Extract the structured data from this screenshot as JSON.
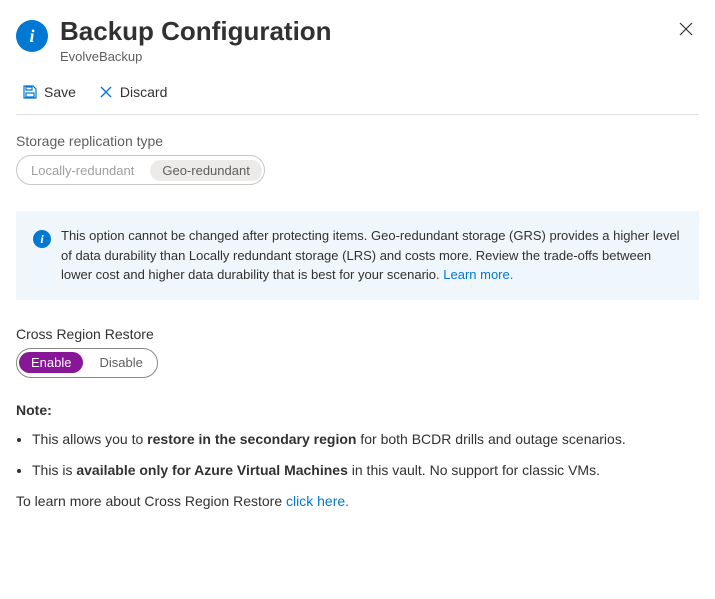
{
  "header": {
    "title": "Backup Configuration",
    "subtitle": "EvolveBackup"
  },
  "toolbar": {
    "save": "Save",
    "discard": "Discard"
  },
  "storageReplication": {
    "label": "Storage replication type",
    "options": {
      "lrs": "Locally-redundant",
      "grs": "Geo-redundant"
    }
  },
  "infoBox": {
    "text": "This option cannot be changed after protecting items.  Geo-redundant storage (GRS) provides a higher level of data durability than Locally redundant storage (LRS) and costs more. Review the trade-offs between lower cost and higher data durability that is best for your scenario. ",
    "learnMore": "Learn more."
  },
  "crossRegion": {
    "label": "Cross Region Restore",
    "enable": "Enable",
    "disable": "Disable"
  },
  "notes": {
    "heading": "Note:",
    "b1_a": "This allows you to ",
    "b1_b": "restore in the secondary region",
    "b1_c": " for both BCDR drills and outage scenarios.",
    "b2_a": "This is ",
    "b2_b": "available only for Azure Virtual Machines",
    "b2_c": " in this vault. No support for classic VMs.",
    "learn_a": "To learn more about Cross Region Restore ",
    "learn_link": "click here."
  }
}
